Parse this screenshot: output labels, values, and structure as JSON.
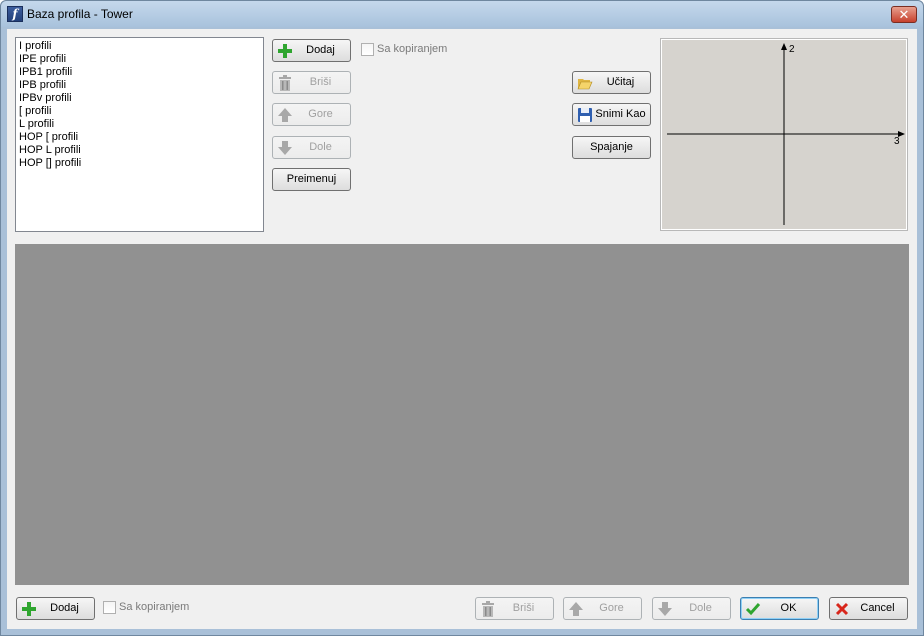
{
  "window": {
    "title": "Baza profila - Tower",
    "close_symbol": "✕"
  },
  "profiles": {
    "items": [
      {
        "label": "I profili"
      },
      {
        "label": "IPE profili"
      },
      {
        "label": "IPB1 profili"
      },
      {
        "label": "IPB profili"
      },
      {
        "label": "IPBv profili"
      },
      {
        "label": "[ profili"
      },
      {
        "label": "L profili"
      },
      {
        "label": "HOP [ profili"
      },
      {
        "label": "HOP L profili"
      },
      {
        "label": "HOP [] profili"
      }
    ]
  },
  "top_buttons": {
    "add": "Dodaj",
    "delete": "Briši",
    "up": "Gore",
    "down": "Dole",
    "rename": "Preimenuj",
    "copy_checkbox": "Sa kopiranjem"
  },
  "file_buttons": {
    "load": "Učitaj",
    "save_as": "Snimi Kao",
    "merge": "Spajanje"
  },
  "preview": {
    "axis_vertical": "2",
    "axis_horizontal": "3"
  },
  "bottom_buttons": {
    "add": "Dodaj",
    "copy_checkbox": "Sa kopiranjem",
    "delete": "Briši",
    "up": "Gore",
    "down": "Dole",
    "ok": "OK",
    "cancel": "Cancel"
  },
  "colors": {
    "add_icon": "#2fa52f",
    "ok_icon": "#2fa52f",
    "cancel_icon": "#d8261b",
    "disabled_icon": "#a8a8a8",
    "grid_bg": "#919191"
  },
  "icons": {
    "add": "plus-icon",
    "delete": "trash-icon",
    "up": "arrow-up-icon",
    "down": "arrow-down-icon",
    "load": "folder-open-icon",
    "save_as": "floppy-disk-icon",
    "ok": "checkmark-icon",
    "cancel": "x-icon"
  }
}
